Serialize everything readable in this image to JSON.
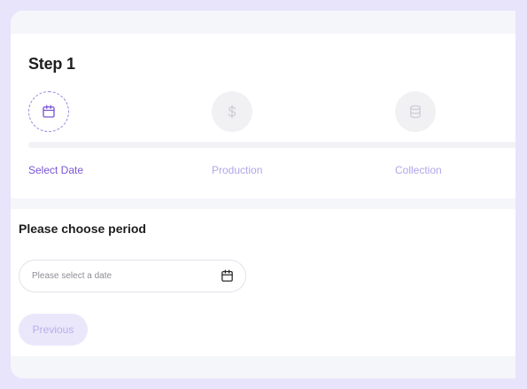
{
  "stepper": {
    "title": "Step 1",
    "steps": [
      {
        "label": "Select Date",
        "icon": "calendar-icon",
        "state": "active"
      },
      {
        "label": "Production",
        "icon": "dollar-icon",
        "state": "inactive"
      },
      {
        "label": "Collection",
        "icon": "database-icon",
        "state": "inactive"
      }
    ]
  },
  "form": {
    "title": "Please choose period",
    "date_placeholder": "Please select a date",
    "previous_label": "Previous"
  },
  "colors": {
    "accent": "#7a55d4",
    "inactive_label": "#b0a6ea",
    "frame": "#e8e4fb"
  }
}
